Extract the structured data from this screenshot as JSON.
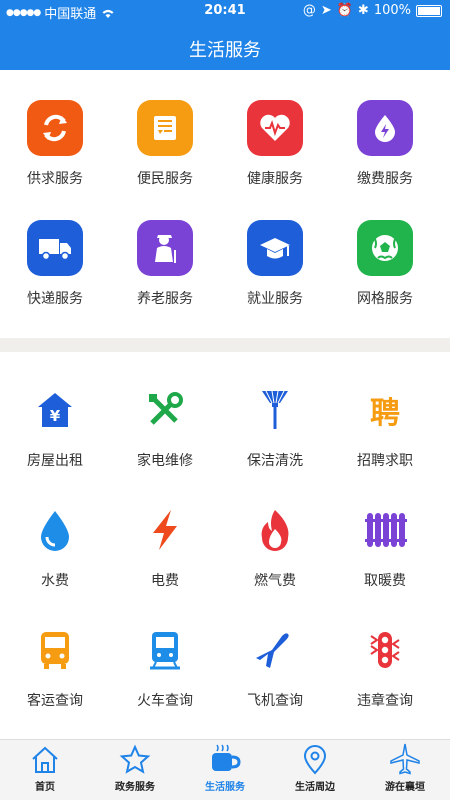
{
  "status": {
    "carrier": "中国联通",
    "time": "20:41",
    "battery": "100%"
  },
  "header": {
    "title": "生活服务"
  },
  "section1": [
    {
      "label": "供求服务",
      "icon": "exchange-icon",
      "color": "#f05a12"
    },
    {
      "label": "便民服务",
      "icon": "card-icon",
      "color": "#f59c12"
    },
    {
      "label": "健康服务",
      "icon": "health-icon",
      "color": "#e8343a"
    },
    {
      "label": "缴费服务",
      "icon": "payment-icon",
      "color": "#7a43d6"
    },
    {
      "label": "快递服务",
      "icon": "truck-icon",
      "color": "#1e5ed8"
    },
    {
      "label": "养老服务",
      "icon": "elderly-icon",
      "color": "#7a43d6"
    },
    {
      "label": "就业服务",
      "icon": "graduation-icon",
      "color": "#1e5ed8"
    },
    {
      "label": "网格服务",
      "icon": "ball-icon",
      "color": "#21b34c"
    }
  ],
  "section2": [
    {
      "label": "房屋出租",
      "icon": "house-icon"
    },
    {
      "label": "家电维修",
      "icon": "tools-icon"
    },
    {
      "label": "保洁清洗",
      "icon": "broom-icon"
    },
    {
      "label": "招聘求职",
      "icon": "recruit-icon",
      "glyph": "聘"
    },
    {
      "label": "水费",
      "icon": "water-icon"
    },
    {
      "label": "电费",
      "icon": "lightning-icon"
    },
    {
      "label": "燃气费",
      "icon": "flame-icon"
    },
    {
      "label": "取暖费",
      "icon": "heater-icon"
    },
    {
      "label": "客运查询",
      "icon": "bus-icon"
    },
    {
      "label": "火车查询",
      "icon": "train-icon"
    },
    {
      "label": "飞机查询",
      "icon": "plane-icon"
    },
    {
      "label": "违章查询",
      "icon": "traffic-light-icon"
    }
  ],
  "tabs": [
    {
      "label": "首页",
      "icon": "home-icon"
    },
    {
      "label": "政务服务",
      "icon": "star-icon"
    },
    {
      "label": "生活服务",
      "icon": "cup-icon",
      "active": true
    },
    {
      "label": "生活周边",
      "icon": "location-icon"
    },
    {
      "label": "游在襄垣",
      "icon": "plane-icon"
    }
  ]
}
